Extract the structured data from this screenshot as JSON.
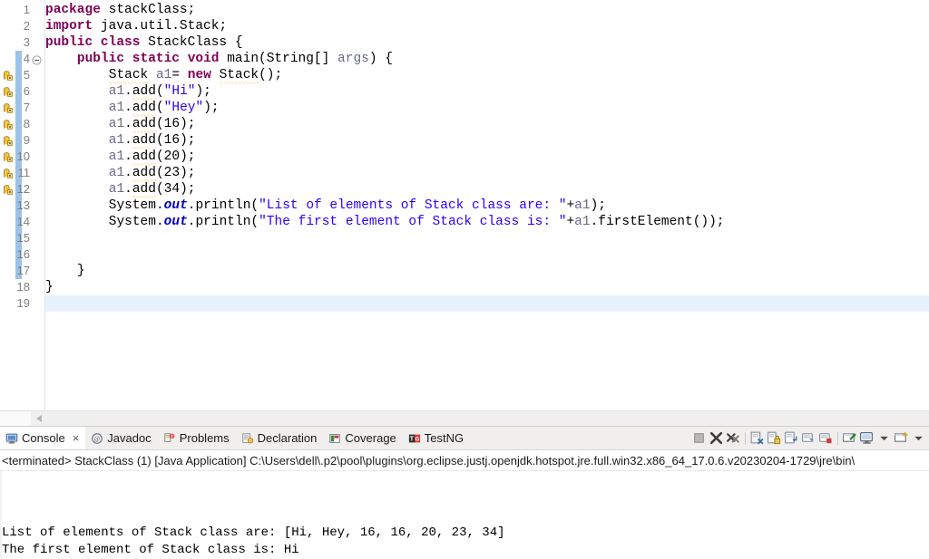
{
  "editor": {
    "total_lines": 19,
    "current_line": 19,
    "change_bar_from_line": 4,
    "change_bar_to_line": 17,
    "fold_marker_line": 4,
    "warning_lines": [
      5,
      6,
      7,
      8,
      9,
      10,
      11,
      12
    ],
    "colors": {
      "keyword": "#7F0055",
      "string": "#2A00FF",
      "static_field": "#0000C0",
      "parameter": "#6A6A8A",
      "line_number": "#808080",
      "current_line_highlight": "#E8F2FE",
      "change_bar": "#9CC2E8",
      "warning_squiggle": "#E8B21A"
    },
    "lines": [
      {
        "n": 1,
        "indent": 0,
        "tokens": [
          {
            "t": "package",
            "c": "kw"
          },
          {
            "t": " stackClass;",
            "c": "plain"
          }
        ]
      },
      {
        "n": 2,
        "indent": 0,
        "tokens": [
          {
            "t": "import",
            "c": "kw"
          },
          {
            "t": " java.util.Stack;",
            "c": "plain"
          }
        ]
      },
      {
        "n": 3,
        "indent": 0,
        "tokens": [
          {
            "t": "public class",
            "c": "kw"
          },
          {
            "t": " StackClass {",
            "c": "plain"
          }
        ]
      },
      {
        "n": 4,
        "indent": 1,
        "tokens": [
          {
            "t": "public static void",
            "c": "kw"
          },
          {
            "t": " main(String[] ",
            "c": "plain"
          },
          {
            "t": "args",
            "c": "param"
          },
          {
            "t": ") {",
            "c": "plain"
          }
        ]
      },
      {
        "n": 5,
        "indent": 2,
        "tokens": [
          {
            "t": "Stack",
            "c": "plain warnline"
          },
          {
            "t": " ",
            "c": "plain"
          },
          {
            "t": "a1",
            "c": "localvar"
          },
          {
            "t": "= ",
            "c": "plain"
          },
          {
            "t": "new",
            "c": "kw"
          },
          {
            "t": " ",
            "c": "plain"
          },
          {
            "t": "Stack",
            "c": "plain warnline"
          },
          {
            "t": "();",
            "c": "plain"
          }
        ]
      },
      {
        "n": 6,
        "indent": 2,
        "tokens": [
          {
            "t": "a1",
            "c": "localvar"
          },
          {
            "t": ".",
            "c": "plain"
          },
          {
            "t": "add",
            "c": "plain warnline"
          },
          {
            "t": "(",
            "c": "plain"
          },
          {
            "t": "\"Hi\"",
            "c": "str"
          },
          {
            "t": ");",
            "c": "plain"
          }
        ]
      },
      {
        "n": 7,
        "indent": 2,
        "tokens": [
          {
            "t": "a1",
            "c": "localvar"
          },
          {
            "t": ".",
            "c": "plain"
          },
          {
            "t": "add",
            "c": "plain warnline"
          },
          {
            "t": "(",
            "c": "plain"
          },
          {
            "t": "\"Hey\"",
            "c": "str"
          },
          {
            "t": ");",
            "c": "plain"
          }
        ]
      },
      {
        "n": 8,
        "indent": 2,
        "tokens": [
          {
            "t": "a1",
            "c": "localvar"
          },
          {
            "t": ".",
            "c": "plain"
          },
          {
            "t": "add",
            "c": "plain warnline"
          },
          {
            "t": "(16);",
            "c": "plain"
          }
        ]
      },
      {
        "n": 9,
        "indent": 2,
        "tokens": [
          {
            "t": "a1",
            "c": "localvar"
          },
          {
            "t": ".",
            "c": "plain"
          },
          {
            "t": "add",
            "c": "plain warnline"
          },
          {
            "t": "(16);",
            "c": "plain"
          }
        ]
      },
      {
        "n": 10,
        "indent": 2,
        "tokens": [
          {
            "t": "a1",
            "c": "localvar"
          },
          {
            "t": ".",
            "c": "plain"
          },
          {
            "t": "add",
            "c": "plain warnline"
          },
          {
            "t": "(20);",
            "c": "plain"
          }
        ]
      },
      {
        "n": 11,
        "indent": 2,
        "tokens": [
          {
            "t": "a1",
            "c": "localvar"
          },
          {
            "t": ".",
            "c": "plain"
          },
          {
            "t": "add",
            "c": "plain warnline"
          },
          {
            "t": "(23);",
            "c": "plain"
          }
        ]
      },
      {
        "n": 12,
        "indent": 2,
        "tokens": [
          {
            "t": "a1",
            "c": "localvar"
          },
          {
            "t": ".",
            "c": "plain"
          },
          {
            "t": "add",
            "c": "plain warnline"
          },
          {
            "t": "(34);",
            "c": "plain"
          }
        ]
      },
      {
        "n": 13,
        "indent": 2,
        "tokens": [
          {
            "t": "System.",
            "c": "plain"
          },
          {
            "t": "out",
            "c": "statfield"
          },
          {
            "t": ".println(",
            "c": "plain"
          },
          {
            "t": "\"List of elements of Stack class are: \"",
            "c": "str"
          },
          {
            "t": "+",
            "c": "plain"
          },
          {
            "t": "a1",
            "c": "localvar"
          },
          {
            "t": ");",
            "c": "plain"
          }
        ]
      },
      {
        "n": 14,
        "indent": 2,
        "tokens": [
          {
            "t": "System.",
            "c": "plain"
          },
          {
            "t": "out",
            "c": "statfield"
          },
          {
            "t": ".println(",
            "c": "plain"
          },
          {
            "t": "\"The first element of Stack class is: \"",
            "c": "str"
          },
          {
            "t": "+",
            "c": "plain"
          },
          {
            "t": "a1",
            "c": "localvar"
          },
          {
            "t": ".firstElement());",
            "c": "plain"
          }
        ]
      },
      {
        "n": 15,
        "indent": 0,
        "tokens": []
      },
      {
        "n": 16,
        "indent": 0,
        "tokens": []
      },
      {
        "n": 17,
        "indent": 1,
        "tokens": [
          {
            "t": "}",
            "c": "plain"
          }
        ]
      },
      {
        "n": 18,
        "indent": 0,
        "tokens": [
          {
            "t": "}",
            "c": "plain"
          }
        ]
      },
      {
        "n": 19,
        "indent": 0,
        "tokens": []
      }
    ]
  },
  "console": {
    "tabs": [
      {
        "label": "Console",
        "icon": "console-icon",
        "active": true,
        "closable": true
      },
      {
        "label": "Javadoc",
        "icon": "javadoc-icon",
        "active": false,
        "closable": false
      },
      {
        "label": "Problems",
        "icon": "problems-icon",
        "active": false,
        "closable": false
      },
      {
        "label": "Declaration",
        "icon": "declaration-icon",
        "active": false,
        "closable": false
      },
      {
        "label": "Coverage",
        "icon": "coverage-icon",
        "active": false,
        "closable": false
      },
      {
        "label": "TestNG",
        "icon": "testng-icon",
        "active": false,
        "closable": false
      }
    ],
    "toolbar": [
      {
        "name": "terminate-button",
        "title": "Terminate"
      },
      {
        "name": "remove-launch-button",
        "title": "Remove Launch"
      },
      {
        "name": "remove-all-launches-button",
        "title": "Remove All Terminated Launches"
      },
      {
        "name": "clear-console-button",
        "title": "Clear Console"
      },
      {
        "name": "scroll-lock-button",
        "title": "Scroll Lock"
      },
      {
        "name": "word-wrap-button",
        "title": "Word Wrap"
      },
      {
        "name": "show-console-stdout-button",
        "title": "Show Console When Standard Out Changes"
      },
      {
        "name": "show-console-stderr-button",
        "title": "Show Console When Standard Error Changes"
      },
      {
        "name": "pin-console-button",
        "title": "Pin Console"
      },
      {
        "name": "display-selected-console-button",
        "title": "Display Selected Console"
      },
      {
        "name": "display-console-dropdown",
        "title": "Display Selected Console Menu"
      },
      {
        "name": "open-console-button",
        "title": "Open Console"
      },
      {
        "name": "open-console-dropdown",
        "title": "Open Console Menu"
      }
    ],
    "status_line": "<terminated> StackClass (1) [Java Application] C:\\Users\\dell\\.p2\\pool\\plugins\\org.eclipse.justj.openjdk.hotspot.jre.full.win32.x86_64_17.0.6.v20230204-1729\\jre\\bin\\",
    "output_lines": [
      "List of elements of Stack class are: [Hi, Hey, 16, 16, 20, 23, 34]",
      "The first element of Stack class is: Hi"
    ]
  }
}
